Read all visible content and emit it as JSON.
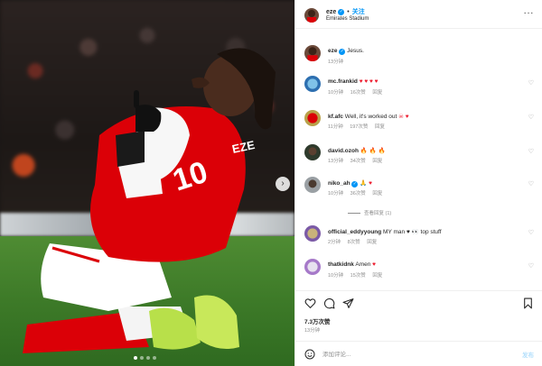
{
  "photo": {
    "jersey_text": "10",
    "name_text": "EZE"
  },
  "post_header": {
    "username": "eze",
    "separator": "•",
    "follow_label": "关注",
    "location": "Emirates Stadium",
    "more_glyph": "···"
  },
  "caption": {
    "username": "eze",
    "text": "Jesus.",
    "time": "13分钟"
  },
  "comments": [
    {
      "username": "mc.frankid",
      "text": "",
      "emoji": "♥ ♥ ♥ ♥",
      "time": "10分钟",
      "likes": "16次赞",
      "reply": "回复"
    },
    {
      "username": "kf.afc",
      "text": "Well, it's worked out",
      "emoji": "☠ ♥",
      "time": "11分钟",
      "likes": "197次赞",
      "reply": "回复"
    },
    {
      "username": "david.ozoh",
      "text": "",
      "emoji": "🔥 🔥 🔥",
      "time": "13分钟",
      "likes": "34次赞",
      "reply": "回复"
    },
    {
      "username": "niko_ah",
      "text": "",
      "emoji": "🙏 ♥",
      "time": "10分钟",
      "likes": "36次赞",
      "reply": "回复"
    },
    {
      "username": "official_eddyyoung",
      "text": "MY man",
      "emoji": "♥ 👀 top stuff",
      "time": "2分钟",
      "likes": "8次赞",
      "reply": "回复"
    },
    {
      "username": "thatkidnk",
      "text": "Amen",
      "emoji": "♥",
      "time": "10分钟",
      "likes": "15次赞",
      "reply": "回复"
    }
  ],
  "view_replies": "查看回复 (1)",
  "post_footer": {
    "likes": "7.3万次赞",
    "time": "13分钟"
  },
  "composer": {
    "placeholder": "添加评论...",
    "post_label": "发布"
  },
  "colors": {
    "accent": "#0095f6",
    "heart": "#ed1d2f",
    "kit_red": "#db0007"
  }
}
